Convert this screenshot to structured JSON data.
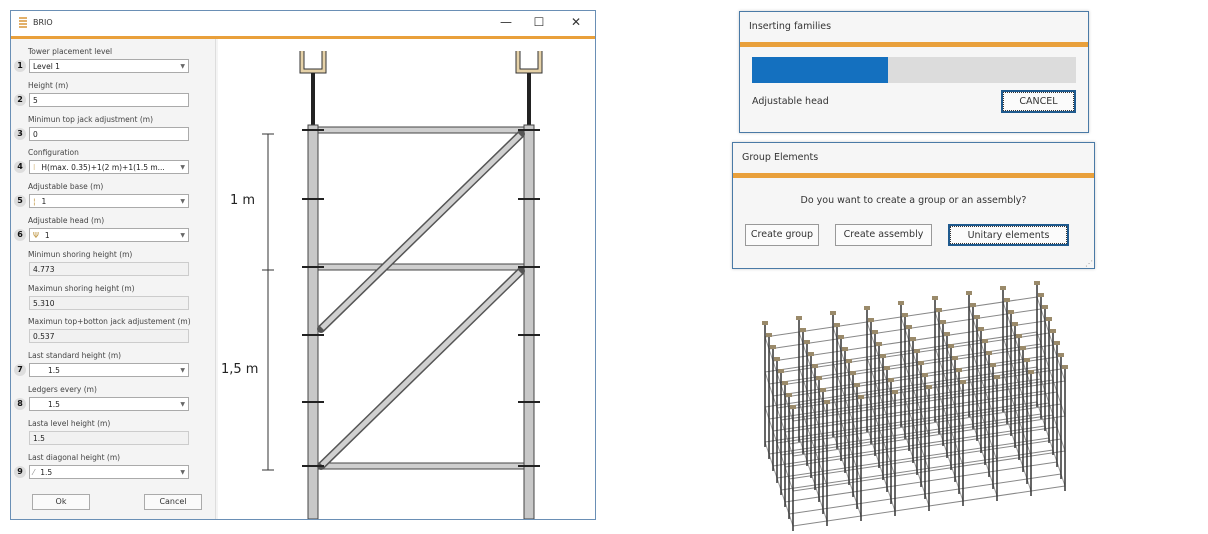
{
  "brio": {
    "title": "BRIO",
    "minimize": "—",
    "maximize": "☐",
    "close": "✕",
    "fields": [
      {
        "num": "",
        "label": "Tower placement level",
        "value": "Level 1",
        "type": "select"
      },
      {
        "num": "2",
        "label": "Height (m)",
        "value": "5",
        "type": "text"
      },
      {
        "num": "3",
        "label": "Minimun top jack adjustment (m)",
        "value": "0",
        "type": "text"
      },
      {
        "num": "4",
        "label": "Configuration",
        "value": "H(max. 0.35)+1(2 m)+1(1.5 m...",
        "type": "select"
      },
      {
        "num": "5",
        "label": "Adjustable base (m)",
        "value": "1",
        "type": "select"
      },
      {
        "num": "6",
        "label": "Adjustable head (m)",
        "value": "1",
        "type": "select"
      },
      {
        "num": "",
        "label": "Minimun shoring height (m)",
        "value": "4.773",
        "type": "readonly"
      },
      {
        "num": "",
        "label": "Maximun shoring height (m)",
        "value": "5.310",
        "type": "readonly"
      },
      {
        "num": "",
        "label": "Maximun top+botton jack adjustement (m)",
        "value": "0.537",
        "type": "readonly"
      },
      {
        "num": "7",
        "label": "Last standard height (m)",
        "value": "1.5",
        "type": "select"
      },
      {
        "num": "8",
        "label": "Ledgers every (m)",
        "value": "1.5",
        "type": "select"
      },
      {
        "num": "",
        "label": "Lasta level height (m)",
        "value": "1.5",
        "type": "readonly"
      },
      {
        "num": "9",
        "label": "Last diagonal height (m)",
        "value": "1.5",
        "type": "select"
      }
    ],
    "first_num": "1",
    "ok": "Ok",
    "cancel": "Cancel",
    "drawing": {
      "dim_top": "1 m",
      "dim_bottom": "1,5 m"
    }
  },
  "inserting": {
    "title": "Inserting families",
    "progress_percent": 42,
    "status": "Adjustable head",
    "cancel": "CANCEL",
    "bar_color": "#1470bf"
  },
  "group": {
    "title": "Group Elements",
    "question": "Do you want to create a group or an assembly?",
    "create_group": "Create group",
    "create_assembly": "Create assembly",
    "unitary": "Unitary elements"
  },
  "accent": "#e9a03b"
}
